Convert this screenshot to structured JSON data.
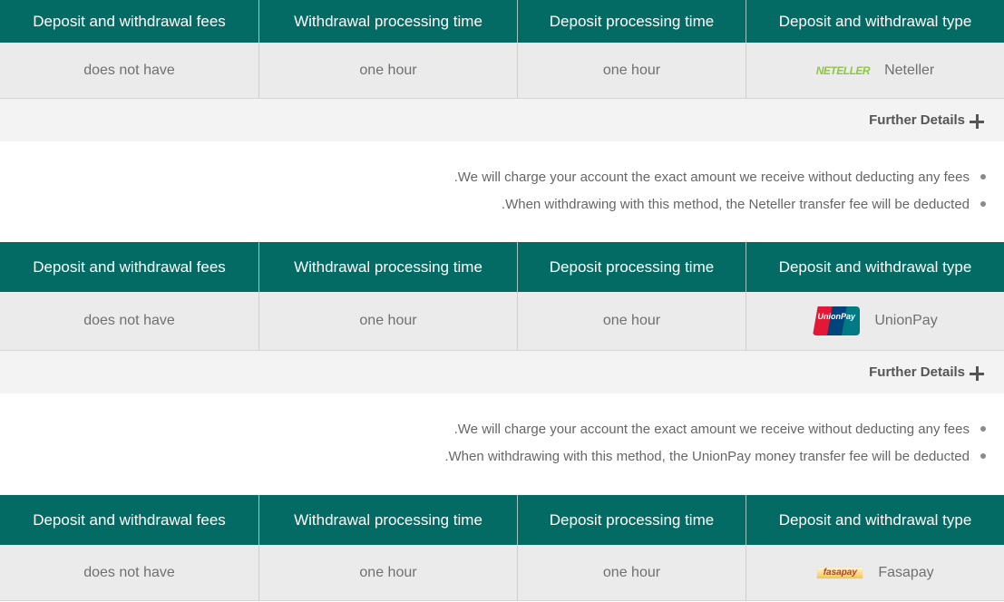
{
  "headers": {
    "fees": "Deposit and withdrawal fees",
    "withdrawal_time": "Withdrawal processing time",
    "deposit_time": "Deposit processing time",
    "type": "Deposit and withdrawal type"
  },
  "further_details_label": "Further Details",
  "methods": [
    {
      "fees": "does not have",
      "withdrawal_time": "one hour",
      "deposit_time": "one hour",
      "type_name": "Neteller",
      "logo_text": "NETELLER",
      "logo_icon": "neteller-logo",
      "notes": [
        ".We will charge your account the exact amount we receive without deducting any fees",
        ".When withdrawing with this method, the Neteller transfer fee will be deducted"
      ]
    },
    {
      "fees": "does not have",
      "withdrawal_time": "one hour",
      "deposit_time": "one hour",
      "type_name": "UnionPay",
      "logo_text": "UnionPay",
      "logo_icon": "unionpay-logo",
      "notes": [
        ".We will charge your account the exact amount we receive without deducting any fees",
        ".When withdrawing with this method, the UnionPay money transfer fee will be deducted"
      ]
    },
    {
      "fees": "does not have",
      "withdrawal_time": "one hour",
      "deposit_time": "one hour",
      "type_name": "Fasapay",
      "logo_text": "fasapay",
      "logo_icon": "fasapay-logo"
    }
  ],
  "colors": {
    "header_bg": "#036b64",
    "row_bg": "#ebebeb",
    "details_bg": "#f3f3f3"
  }
}
